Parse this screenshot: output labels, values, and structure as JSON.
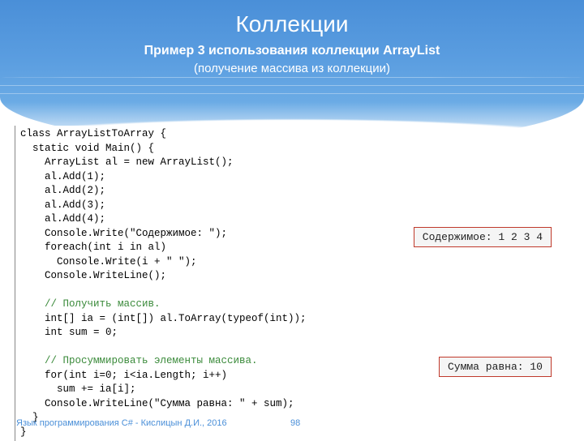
{
  "title": "Коллекции",
  "subtitle1": "Пример 3 использования коллекции ArrayList",
  "subtitle2": "(получение массива из коллекции)",
  "code": {
    "l1": "class ArrayListToArray {",
    "l2": "  static void Main() {",
    "l3": "    ArrayList al = new ArrayList();",
    "l4": "    al.Add(1);",
    "l5": "    al.Add(2);",
    "l6": "    al.Add(3);",
    "l7": "    al.Add(4);",
    "l8": "    Console.Write(\"Содержимое: \");",
    "l9": "    foreach(int i in al)",
    "l10": "      Console.Write(i + \" \");",
    "l11": "    Console.WriteLine();",
    "l12": "",
    "l13": "    // Получить массив.",
    "l14": "    int[] ia = (int[]) al.ToArray(typeof(int));",
    "l15": "    int sum = 0;",
    "l16": "",
    "l17": "    // Просуммировать элементы массива.",
    "l18": "    for(int i=0; i<ia.Length; i++)",
    "l19": "      sum += ia[i];",
    "l20": "    Console.WriteLine(\"Сумма равна: \" + sum);",
    "l21": "  }",
    "l22": "}"
  },
  "output1": "Содержимое: 1 2 3 4",
  "output2": "Сумма равна: 10",
  "footer": "Язык программирования C# - Кислицын Д.И., 2016",
  "pagenum": "98"
}
